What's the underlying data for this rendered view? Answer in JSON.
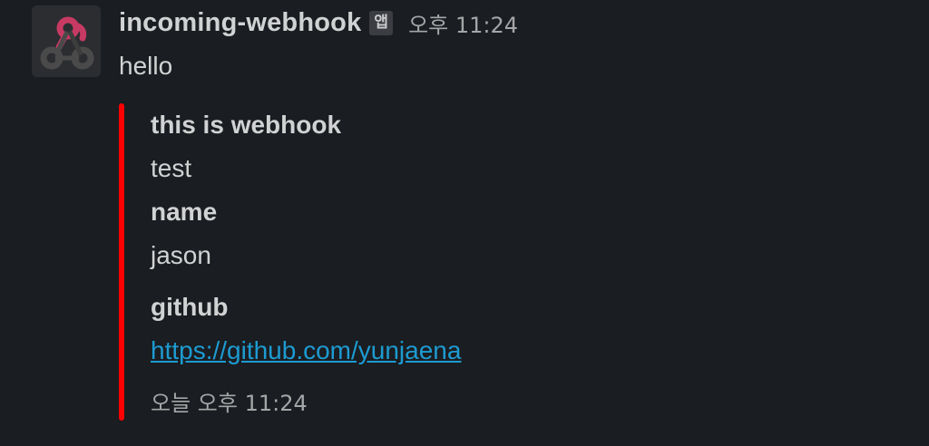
{
  "message": {
    "avatar_icon": "webhook-icon",
    "username": "incoming-webhook",
    "app_badge": "앱",
    "timestamp": "오후 11:24",
    "text": "hello"
  },
  "attachment": {
    "color": "#ff0000",
    "title": "this is webhook",
    "text": "test",
    "fields": [
      {
        "title": "name",
        "value": "jason"
      },
      {
        "title": "github",
        "value": "https://github.com/yunjaena"
      }
    ],
    "footer_timestamp": "오늘 오후 11:24"
  },
  "colors": {
    "background": "#1a1d21",
    "text": "#d1d2d3",
    "muted": "#a5a6a8",
    "link": "#1d9bd1",
    "attachment_bar": "#ff0000"
  }
}
